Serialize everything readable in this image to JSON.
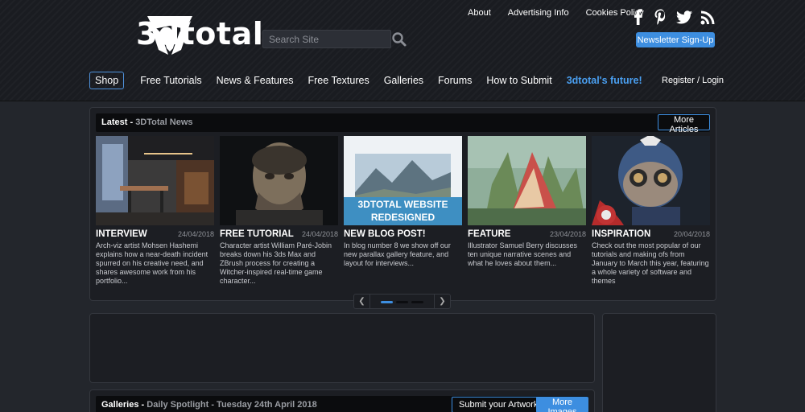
{
  "header": {
    "logo_text": "3dtotal",
    "search_placeholder": "Search Site",
    "top_links": [
      "About",
      "Advertising Info",
      "Cookies Policy"
    ],
    "social_icons": [
      "facebook-icon",
      "pinterest-icon",
      "twitter-icon",
      "rss-icon"
    ],
    "newsletter_label": "Newsletter Sign-Up",
    "nav": [
      "Shop",
      "Free Tutorials",
      "News & Features",
      "Free Textures",
      "Galleries",
      "Forums",
      "How to Submit",
      "3dtotal's future!"
    ],
    "login_label": "Register / Login"
  },
  "latest": {
    "title": "Latest - ",
    "subtitle": "3DTotal News",
    "more_label": "More Articles",
    "articles": [
      {
        "category": "INTERVIEW",
        "date": "24/04/2018",
        "desc": "Arch-viz artist Mohsen Hashemi explains how a near-death incident spurred on his creative need, and shares awesome work from his portfolio..."
      },
      {
        "category": "FREE TUTORIAL",
        "date": "24/04/2018",
        "desc": "Character artist William Paré-Jobin breaks down his 3ds Max and ZBrush process for creating a Witcher-inspired real-time game character..."
      },
      {
        "category": "NEW BLOG POST!",
        "date": "",
        "desc": "In blog number 8 we show off our new parallax gallery feature, and layout for interviews...",
        "banner_line1": "3DTOTAL WEBSITE",
        "banner_line2": "REDESIGNED"
      },
      {
        "category": "FEATURE",
        "date": "23/04/2018",
        "desc": "Illustrator Samuel Berry discusses ten unique narrative scenes and what he loves about them..."
      },
      {
        "category": "INSPIRATION",
        "date": "20/04/2018",
        "desc": "Check out the most popular of our tutorials and making ofs from January to March this year, featuring a whole variety of software and themes"
      }
    ],
    "active_page": 1
  },
  "galleries": {
    "title": "Galleries - ",
    "subtitle": "Daily Spotlight - Tuesday 24th April 2018",
    "submit_label": "Submit your Artwork",
    "more_label": "More Images"
  },
  "colors": {
    "accent": "#3d8ee0",
    "background": "#23262c",
    "header": "#1a1c21"
  }
}
